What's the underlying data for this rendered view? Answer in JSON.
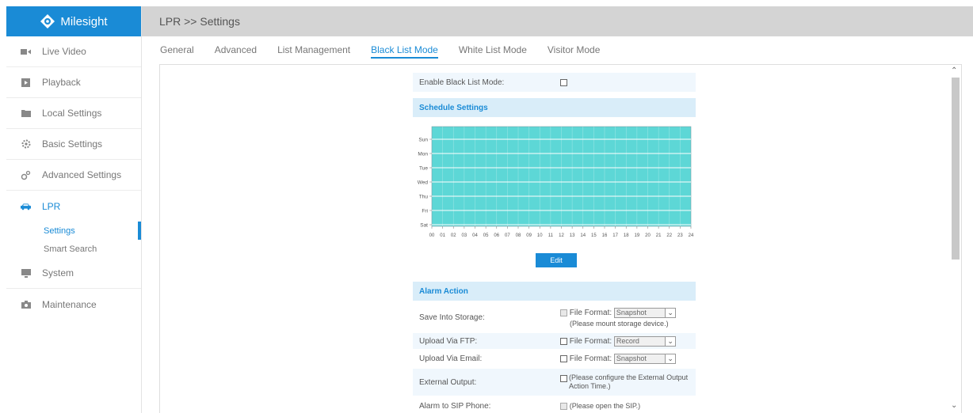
{
  "brand": {
    "name": "Milesight",
    "color": "#1a8bd6"
  },
  "sidebar": {
    "items": [
      {
        "label": "Live Video",
        "icon": "video-icon"
      },
      {
        "label": "Playback",
        "icon": "playback-icon"
      },
      {
        "label": "Local Settings",
        "icon": "folder-icon"
      },
      {
        "label": "Basic Settings",
        "icon": "gear-icon"
      },
      {
        "label": "Advanced Settings",
        "icon": "gears-icon"
      },
      {
        "label": "LPR",
        "icon": "car-icon"
      },
      {
        "label": "System",
        "icon": "monitor-icon"
      },
      {
        "label": "Maintenance",
        "icon": "camera-icon"
      }
    ],
    "lpr_sub": [
      {
        "label": "Settings"
      },
      {
        "label": "Smart Search"
      }
    ]
  },
  "header": {
    "breadcrumb": "LPR >> Settings"
  },
  "tabs": [
    {
      "label": "General"
    },
    {
      "label": "Advanced"
    },
    {
      "label": "List Management"
    },
    {
      "label": "Black List Mode"
    },
    {
      "label": "White List Mode"
    },
    {
      "label": "Visitor Mode"
    }
  ],
  "enable": {
    "label": "Enable Black List Mode:",
    "checked": false
  },
  "schedule": {
    "title": "Schedule Settings",
    "days": [
      "Sun",
      "Mon",
      "Tue",
      "Wed",
      "Thu",
      "Fri",
      "Sat"
    ],
    "hours": [
      "00",
      "01",
      "02",
      "03",
      "04",
      "05",
      "06",
      "07",
      "08",
      "09",
      "10",
      "11",
      "12",
      "13",
      "14",
      "15",
      "16",
      "17",
      "18",
      "19",
      "20",
      "21",
      "22",
      "23",
      "24"
    ],
    "fill_color": "#5dd7d6",
    "edit_label": "Edit"
  },
  "alarm": {
    "title": "Alarm Action",
    "rows": [
      {
        "label": "Save Into Storage:",
        "prefix": "File Format:",
        "format": "Snapshot",
        "note": "(Please mount storage device.)"
      },
      {
        "label": "Upload Via FTP:",
        "prefix": "File Format:",
        "format": "Record"
      },
      {
        "label": "Upload Via Email:",
        "prefix": "File Format:",
        "format": "Snapshot"
      },
      {
        "label": "External Output:",
        "text": "(Please configure the External Output Action Time.)"
      },
      {
        "label": "Alarm to SIP Phone:",
        "text": "(Please open the SIP.)"
      }
    ]
  }
}
